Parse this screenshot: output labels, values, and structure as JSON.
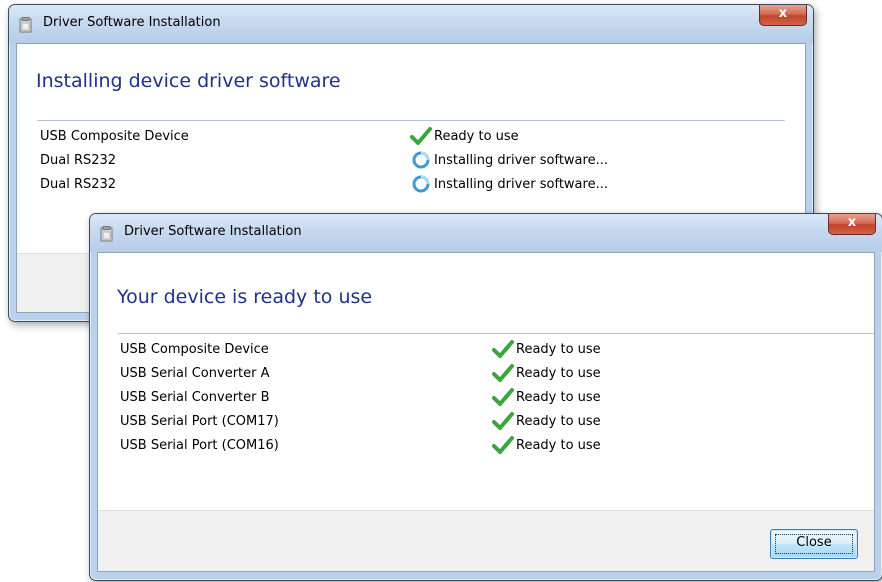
{
  "back_window": {
    "title": "Driver Software Installation",
    "close_label": "x",
    "heading": "Installing device driver software",
    "devices": [
      {
        "name": "USB Composite Device",
        "status": "Ready to use",
        "icon": "checkmark-icon"
      },
      {
        "name": "Dual RS232",
        "status": "Installing driver software...",
        "icon": "spinner-icon"
      },
      {
        "name": "Dual RS232",
        "status": "Installing driver software...",
        "icon": "spinner-icon"
      }
    ]
  },
  "front_window": {
    "title": "Driver Software Installation",
    "close_label": "x",
    "heading": "Your device is ready to use",
    "devices": [
      {
        "name": "USB Composite Device",
        "status": "Ready to use",
        "icon": "checkmark-icon"
      },
      {
        "name": "USB Serial Converter A",
        "status": "Ready to use",
        "icon": "checkmark-icon"
      },
      {
        "name": "USB Serial Converter B",
        "status": "Ready to use",
        "icon": "checkmark-icon"
      },
      {
        "name": "USB Serial Port (COM17)",
        "status": "Ready to use",
        "icon": "checkmark-icon"
      },
      {
        "name": "USB Serial Port (COM16)",
        "status": "Ready to use",
        "icon": "checkmark-icon"
      }
    ],
    "close_button_label": "Close"
  },
  "colors": {
    "heading": "#1e3287",
    "check_green": "#3aa53a",
    "spinner_blue": "#3d9bd6",
    "frame": "#b9d1ea"
  }
}
